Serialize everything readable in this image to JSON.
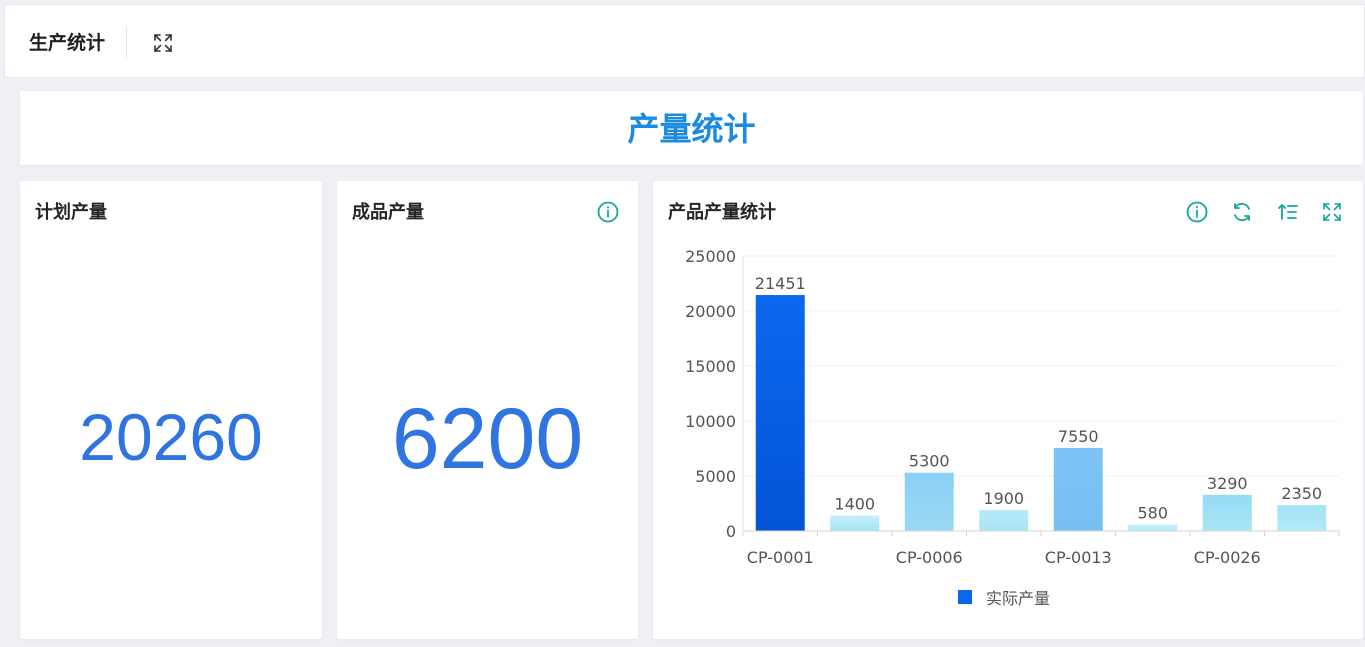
{
  "header": {
    "title": "生产统计",
    "expand_icon": "expand-icon"
  },
  "banner": {
    "title": "产量统计"
  },
  "cards": {
    "planned": {
      "title": "计划产量",
      "value": "20260"
    },
    "finished": {
      "title": "成品产量",
      "value": "6200",
      "info_icon": "info-icon"
    },
    "product": {
      "title": "产品产量统计",
      "icons": [
        "info-icon",
        "refresh-icon",
        "sort-icon",
        "expand-icon"
      ]
    }
  },
  "colors": {
    "accent": "#1a8be0",
    "number": "#2f74e0",
    "icon_teal": "#13a89e",
    "bar_top": "#0a68ef",
    "legend": "#0a68ef"
  },
  "chart_data": {
    "type": "bar",
    "categories": [
      "CP-0001",
      "",
      "CP-0006",
      "",
      "CP-0013",
      "",
      "CP-0026",
      ""
    ],
    "series": [
      {
        "name": "实际产量",
        "values": [
          21451,
          1400,
          5300,
          1900,
          7550,
          580,
          3290,
          2350
        ]
      }
    ],
    "y_ticks": [
      "0",
      "5000",
      "10000",
      "15000",
      "20000",
      "25000"
    ],
    "ylim": [
      0,
      25000
    ],
    "grid": true,
    "legend": "bottom-center"
  }
}
